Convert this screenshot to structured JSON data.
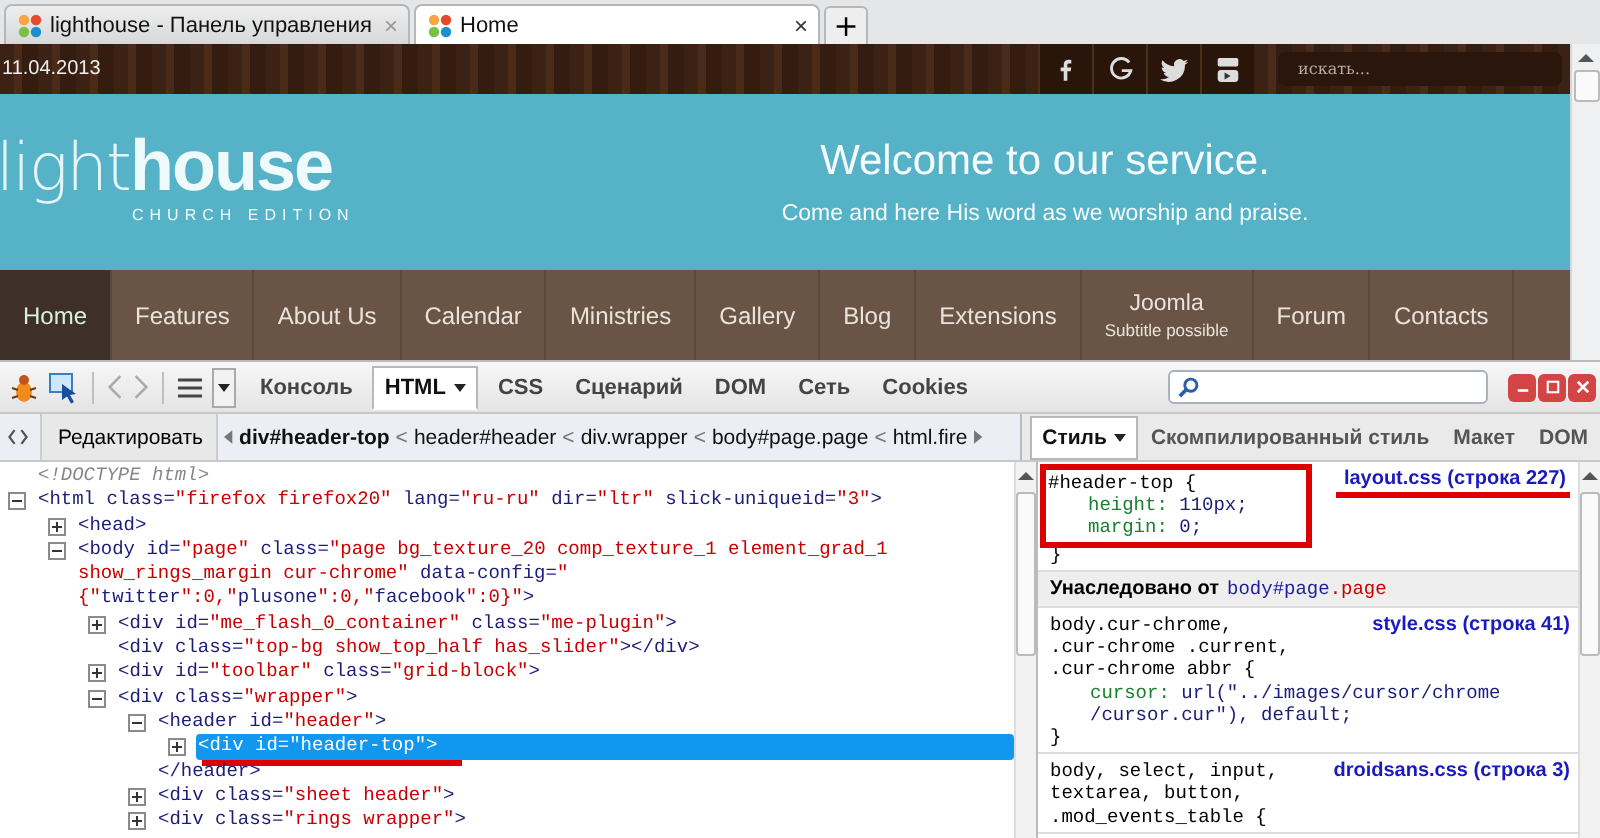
{
  "browser_tabs": [
    {
      "title": "lighthouse - Панель управления",
      "close": "×",
      "selected": false
    },
    {
      "title": "Home",
      "close": "×",
      "selected": true
    }
  ],
  "new_tab": "+",
  "site": {
    "date": "11.04.2013",
    "search": {
      "placeholder": "искать..."
    },
    "logo": {
      "light": "light",
      "house": "house",
      "subtitle": "CHURCH EDITION"
    },
    "welcome": {
      "title": "Welcome to our service.",
      "subtitle": "Come and here His word as we worship and praise."
    },
    "nav": [
      {
        "label": "Home",
        "selected": true
      },
      {
        "label": "Features",
        "selected": false
      },
      {
        "label": "About Us",
        "selected": false
      },
      {
        "label": "Calendar",
        "selected": false
      },
      {
        "label": "Ministries",
        "selected": false
      },
      {
        "label": "Gallery",
        "selected": false
      },
      {
        "label": "Blog",
        "selected": false
      },
      {
        "label": "Extensions",
        "selected": false
      },
      {
        "label": "Joomla",
        "subtitle": "Subtitle possible",
        "selected": false
      },
      {
        "label": "Forum",
        "selected": false
      },
      {
        "label": "Contacts",
        "selected": false
      }
    ]
  },
  "devtools": {
    "tabs": [
      {
        "label": "Консоль",
        "dropdown": false,
        "selected": false
      },
      {
        "label": "HTML",
        "dropdown": true,
        "selected": true
      },
      {
        "label": "CSS",
        "dropdown": false,
        "selected": false
      },
      {
        "label": "Сценарий",
        "dropdown": false,
        "selected": false
      },
      {
        "label": "DOM",
        "dropdown": false,
        "selected": false
      },
      {
        "label": "Сеть",
        "dropdown": false,
        "selected": false
      },
      {
        "label": "Cookies",
        "dropdown": false,
        "selected": false
      }
    ],
    "edit_button": "Редактировать",
    "breadcrumbs": [
      {
        "label": "div#header-top",
        "separator": "<",
        "selected": true
      },
      {
        "label": "header#header",
        "separator": "<",
        "selected": false
      },
      {
        "label": "div.wrapper",
        "separator": "<",
        "selected": false
      },
      {
        "label": "body#page.page",
        "separator": "<",
        "selected": false
      },
      {
        "label": "html.fire",
        "selected": false
      }
    ],
    "side_tabs": [
      {
        "label": "Стиль",
        "dropdown": true,
        "selected": true
      },
      {
        "label": "Скомпилированный стиль",
        "dropdown": false,
        "selected": false
      },
      {
        "label": "Макет",
        "dropdown": false,
        "selected": false
      },
      {
        "label": "DOM",
        "dropdown": false,
        "selected": false
      }
    ],
    "tree": [
      {
        "kind": "doctype",
        "text": "<!DOCTYPE html>",
        "selected": false
      },
      {
        "kind": "element",
        "text": "<html class=\"firefox firefox20\" lang=\"ru-ru\" dir=\"ltr\" slick-uniqueid=\"3\">",
        "expanded": true,
        "selected": false,
        "children": [
          {
            "kind": "element",
            "text": "<head>",
            "expanded": false,
            "selected": false
          },
          {
            "kind": "element",
            "text": "<body id=\"page\" class=\"page bg_texture_20 comp_texture_1 element_grad_1\nshow_rings_margin cur-chrome\" data-config=\"\n{\"twitter\":0,\"plusone\":0,\"facebook\":0}\">",
            "expanded": true,
            "selected": false,
            "children": [
              {
                "kind": "element",
                "text": "<div id=\"me_flash_0_container\" class=\"me-plugin\">",
                "expanded": false,
                "selected": false
              },
              {
                "kind": "element",
                "text": "<div class=\"top-bg show_top_half has_slider\"></div>",
                "selected": false
              },
              {
                "kind": "element",
                "text": "<div id=\"toolbar\" class=\"grid-block\">",
                "expanded": false,
                "selected": false
              },
              {
                "kind": "element",
                "text": "<div class=\"wrapper\">",
                "expanded": true,
                "selected": false,
                "children": [
                  {
                    "kind": "element",
                    "text": "<header id=\"header\">",
                    "expanded": true,
                    "selected": false,
                    "closing": "</header>",
                    "children": [
                      {
                        "kind": "element",
                        "text": "<div id=\"header-top\">",
                        "expanded": false,
                        "selected": true
                      }
                    ]
                  },
                  {
                    "kind": "element",
                    "text": "<div class=\"sheet header\">",
                    "expanded": false,
                    "selected": false
                  },
                  {
                    "kind": "element",
                    "text": "<div class=\"rings wrapper\">",
                    "expanded": false,
                    "selected": false
                  }
                ]
              }
            ]
          }
        ]
      }
    ],
    "css_rules": [
      {
        "selector": "#header-top {",
        "source": "layout.css (строка 227)",
        "annotated": true,
        "props": [
          {
            "name": "height:",
            "value": "110px;"
          },
          {
            "name": "margin:",
            "value": "0;"
          }
        ],
        "closing": "}"
      }
    ],
    "inherited": {
      "label": "Унаследовано от",
      "element": "body#page",
      "class": ".page"
    },
    "inherited_rules": [
      {
        "selector": "body.cur-chrome,\n.cur-chrome .current,\n.cur-chrome abbr {",
        "source": "style.css (строка 41)",
        "annotated": false,
        "props": [
          {
            "name": "cursor:",
            "value": "url(\"../images/cursor/chrome\n/cursor.cur\"), default;"
          }
        ],
        "closing": "}"
      },
      {
        "selector": "body, select, input,\ntextarea, button,\n.mod_events_table {",
        "source": "droidsans.css (строка 3)",
        "annotated": false
      }
    ]
  }
}
